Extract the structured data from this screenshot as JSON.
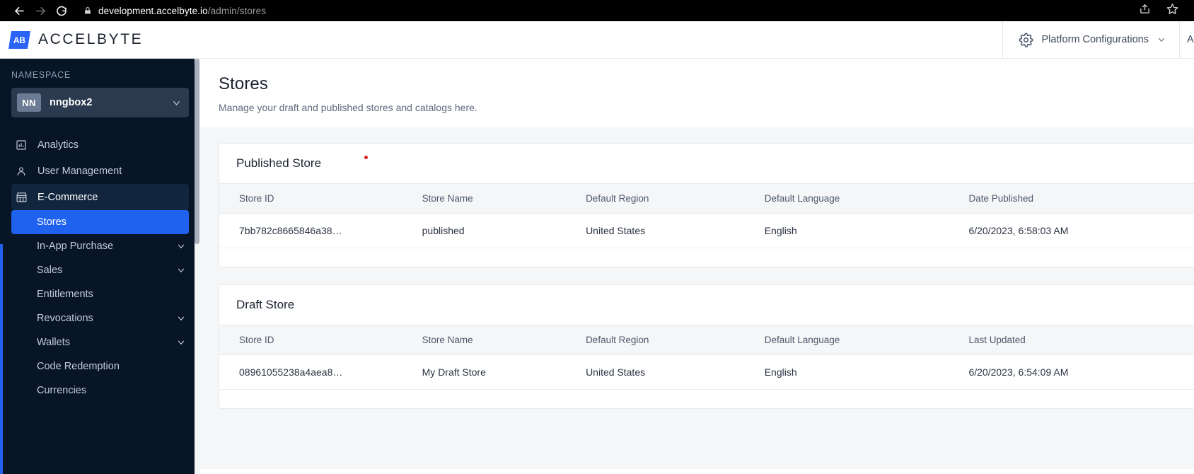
{
  "browser": {
    "back_icon": "back-arrow-icon",
    "forward_icon": "forward-arrow-icon",
    "reload_icon": "reload-icon",
    "lock_icon": "lock-icon",
    "url_domain": "development.accelbyte.io",
    "url_path": "/admin/stores",
    "share_icon": "share-icon",
    "bookmark_icon": "star-icon"
  },
  "header": {
    "logo_mark": "AB",
    "logo_text": "ACCELBYTE",
    "platform_config_label": "Platform Configurations",
    "gear_icon": "gear-icon",
    "chevron_icon": "chevron-down-icon",
    "user_partial": "A"
  },
  "sidebar": {
    "namespace_label": "NAMESPACE",
    "namespace_badge": "NN",
    "namespace_value": "nngbox2",
    "items": [
      {
        "label": "Analytics",
        "icon": "bar-chart-icon",
        "expandable": false
      },
      {
        "label": "User Management",
        "icon": "user-icon",
        "expandable": false
      },
      {
        "label": "E-Commerce",
        "icon": "store-icon",
        "expandable": false
      }
    ],
    "sub_items": [
      {
        "label": "Stores",
        "expandable": false,
        "selected": true
      },
      {
        "label": "In-App Purchase",
        "expandable": true,
        "selected": false
      },
      {
        "label": "Sales",
        "expandable": true,
        "selected": false
      },
      {
        "label": "Entitlements",
        "expandable": false,
        "selected": false
      },
      {
        "label": "Revocations",
        "expandable": true,
        "selected": false
      },
      {
        "label": "Wallets",
        "expandable": true,
        "selected": false
      },
      {
        "label": "Code Redemption",
        "expandable": false,
        "selected": false
      },
      {
        "label": "Currencies",
        "expandable": false,
        "selected": false
      }
    ]
  },
  "main": {
    "page_title": "Stores",
    "page_subtitle": "Manage your draft and published stores and catalogs here.",
    "published_card": {
      "title": "Published Store",
      "has_red_dot": true,
      "columns": [
        "Store ID",
        "Store Name",
        "Default Region",
        "Default Language",
        "Date Published"
      ],
      "rows": [
        {
          "store_id": "7bb782c8665846a38…",
          "store_name": "published",
          "default_region": "United States",
          "default_language": "English",
          "date": "6/20/2023, 6:58:03 AM"
        }
      ]
    },
    "draft_card": {
      "title": "Draft Store",
      "has_red_dot": false,
      "columns": [
        "Store ID",
        "Store Name",
        "Default Region",
        "Default Language",
        "Last Updated"
      ],
      "rows": [
        {
          "store_id": "08961055238a4aea8…",
          "store_name": "My Draft Store",
          "default_region": "United States",
          "default_language": "English",
          "date": "6/20/2023, 6:54:09 AM"
        }
      ]
    }
  },
  "colors": {
    "accent_blue": "#1f62ef",
    "sidebar_bg": "#071527",
    "red_dot": "#e02020"
  }
}
